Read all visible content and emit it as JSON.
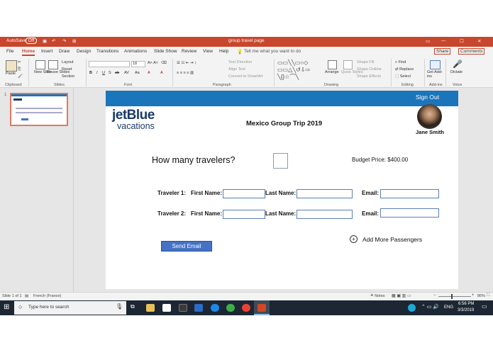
{
  "titlebar": {
    "autosave": "AutoSave",
    "autosave_state": "Off",
    "doc_title": "group travel page"
  },
  "tabs": [
    "File",
    "Home",
    "Insert",
    "Draw",
    "Design",
    "Transitions",
    "Animations",
    "Slide Show",
    "Review",
    "View",
    "Help"
  ],
  "tell_me": "Tell me what you want to do",
  "share": "Share",
  "comments": "Comments",
  "ribbon": {
    "paste": "Paste",
    "new_slide": "New Slide",
    "reuse_slides": "Reuse Slides",
    "layout": "Layout",
    "reset": "Reset",
    "section": "Section",
    "font_size": "18",
    "text_direction": "Text Direction",
    "align_text": "Align Text",
    "convert_smartart": "Convert to SmartArt",
    "arrange": "Arrange",
    "quick_styles": "Quick Styles",
    "shape_fill": "Shape Fill",
    "shape_outline": "Shape Outline",
    "shape_effects": "Shape Effects",
    "find": "Find",
    "replace": "Replace",
    "select": "Select",
    "get_addins": "Get Add-ins",
    "dictate": "Dictate",
    "groups": {
      "clipboard": "Clipboard",
      "slides": "Slides",
      "font": "Font",
      "paragraph": "Paragraph",
      "drawing": "Drawing",
      "editing": "Editing",
      "addins": "Add-ins",
      "voice": "Voice"
    }
  },
  "thumbnail": {
    "number": "1"
  },
  "slide": {
    "sign_out": "Sign Out",
    "logo_top": "jetBlue",
    "logo_bottom": "vacations",
    "trip_title": "Mexico Group Trip 2019",
    "user_name": "Jane Smith",
    "travelers_question": "How many travelers?",
    "budget": "Budget Price: $400.00",
    "traveler1": "Traveler 1:",
    "traveler2": "Traveler 2:",
    "first_name": "First Name:",
    "last_name": "Last Name:",
    "email": "Email:",
    "add_more_icon": "+",
    "add_more": "Add More Passengers",
    "send_email": "Send Email"
  },
  "status": {
    "slide_count": "Slide 1 of 1",
    "language": "French (France)",
    "notes": "Notes",
    "zoom": "86%"
  },
  "taskbar": {
    "search_placeholder": "Type here to search",
    "time": "6:56 PM",
    "date": "3/3/2019",
    "lang": "ENG"
  }
}
